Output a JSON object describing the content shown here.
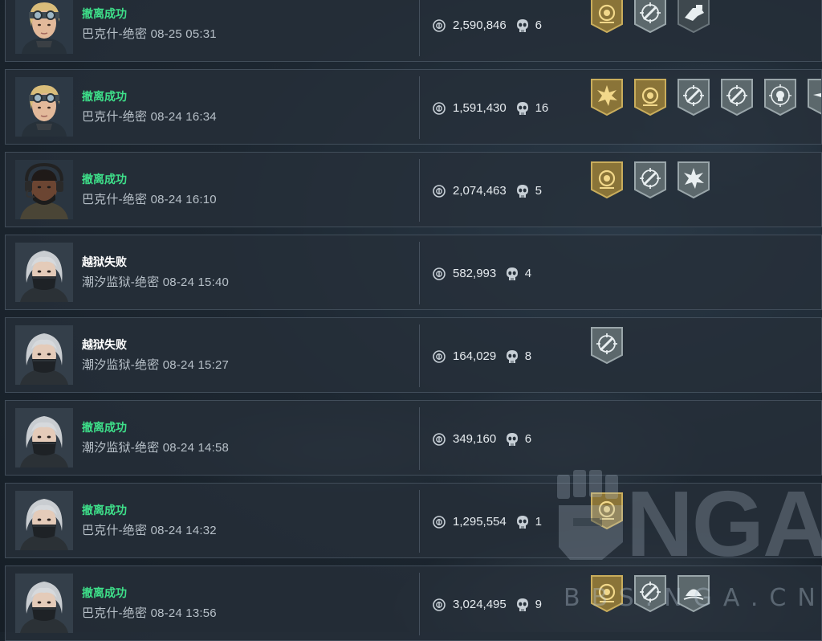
{
  "colors": {
    "success": "#3ee08a",
    "failure": "#ffffff",
    "badge_gold": "#8a7438",
    "badge_silver": "#5c686c",
    "badge_dark": "#3e484e"
  },
  "watermark": {
    "logo": "NGA",
    "sub": "BBS.NGA.CN"
  },
  "records": [
    {
      "portrait": "blonde-goggles-portrait",
      "status": "撤离成功",
      "status_type": "ok",
      "meta": "巴克什-绝密 08-25 05:31",
      "money": "2,590,846",
      "kills": "6",
      "badges": [
        "gold-emblem-badge",
        "silver-crosshair-badge",
        "dark-hand-badge"
      ]
    },
    {
      "portrait": "blonde-goggles-portrait",
      "status": "撤离成功",
      "status_type": "ok",
      "meta": "巴克什-绝密 08-24 16:34",
      "money": "1,591,430",
      "kills": "16",
      "badges": [
        "gold-burst-badge",
        "gold-emblem-badge",
        "silver-crosshair-badge",
        "silver-crosshair-badge",
        "silver-skull-target-badge",
        "silver-star-badge"
      ]
    },
    {
      "portrait": "headset-soldier-portrait",
      "status": "撤离成功",
      "status_type": "ok",
      "meta": "巴克什-绝密 08-24 16:10",
      "money": "2,074,463",
      "kills": "5",
      "badges": [
        "gold-emblem-badge",
        "silver-crosshair-badge",
        "silver-burst-badge"
      ]
    },
    {
      "portrait": "masked-woman-portrait",
      "status": "越狱失败",
      "status_type": "fail",
      "meta": "潮汐监狱-绝密 08-24 15:40",
      "money": "582,993",
      "kills": "4",
      "badges": []
    },
    {
      "portrait": "masked-woman-portrait",
      "status": "越狱失败",
      "status_type": "fail",
      "meta": "潮汐监狱-绝密 08-24 15:27",
      "money": "164,029",
      "kills": "8",
      "badges": [
        "silver-crosshair-badge"
      ]
    },
    {
      "portrait": "masked-woman-portrait",
      "status": "撤离成功",
      "status_type": "ok",
      "meta": "潮汐监狱-绝密 08-24 14:58",
      "money": "349,160",
      "kills": "6",
      "badges": []
    },
    {
      "portrait": "masked-woman-portrait",
      "status": "撤离成功",
      "status_type": "ok",
      "meta": "巴克什-绝密 08-24 14:32",
      "money": "1,295,554",
      "kills": "1",
      "badges": [
        "gold-emblem-badge"
      ]
    },
    {
      "portrait": "masked-woman-portrait",
      "status": "撤离成功",
      "status_type": "ok",
      "meta": "巴克什-绝密 08-24 13:56",
      "money": "3,024,495",
      "kills": "9",
      "badges": [
        "gold-emblem-badge",
        "silver-crosshair-badge",
        "silver-dome-badge"
      ]
    }
  ]
}
